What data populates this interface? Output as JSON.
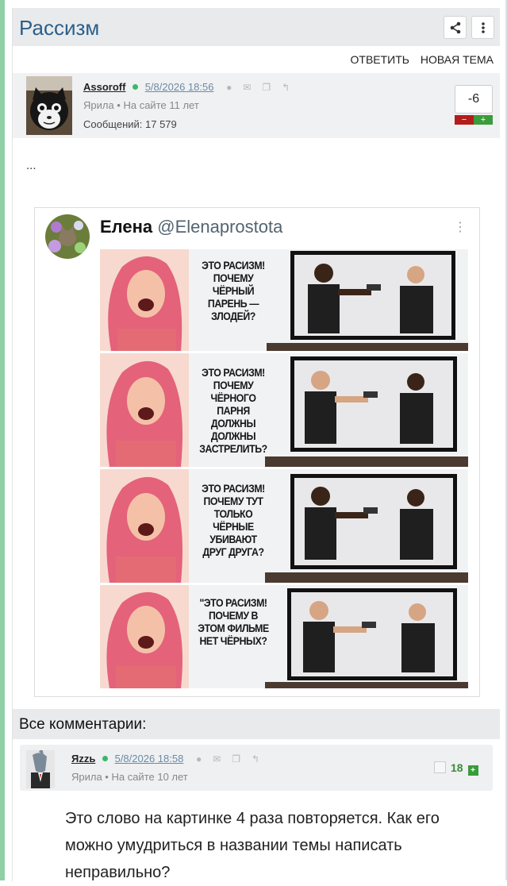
{
  "topic": {
    "title": "Рассизм",
    "actions": [
      "ОТВЕТИТЬ",
      "НОВАЯ ТЕМА"
    ]
  },
  "post": {
    "author": "Assoroff",
    "date": "5/8/2026 18:56",
    "meta": "Ярила • На сайте 11 лет",
    "messages": "Сообщений: 17 579",
    "rating": "-6",
    "rating_minus": "−",
    "rating_plus": "+",
    "body": "..."
  },
  "tweet": {
    "name": "Елена",
    "handle": "@Elenaprostota",
    "panels": [
      {
        "line": "ЭТО РАСИЗМ! ПОЧЕМУ ЧЁРНЫЙ ПАРЕНЬ — ЗЛОДЕЙ?"
      },
      {
        "line": "ЭТО РАСИЗМ! ПОЧЕМУ ЧЁРНОГО ПАРНЯ ДОЛЖНЫ ДОЛЖНЫ ЗАСТРЕЛИТЬ?"
      },
      {
        "line": "ЭТО РАСИЗМ! ПОЧЕМУ ТУТ ТОЛЬКО ЧЁРНЫЕ УБИВАЮТ ДРУГ ДРУГА?"
      },
      {
        "line": "\"ЭТО РАСИЗМ! ПОЧЕМУ В ЭТОМ ФИЛЬМЕ НЕТ ЧЁРНЫХ?"
      }
    ]
  },
  "comments_section": {
    "title": "Все комментарии:"
  },
  "comment": {
    "author": "Яzzь",
    "date": "5/8/2026 18:58",
    "meta": "Ярила • На сайте 10 лет",
    "rating": "18",
    "text": "Это слово на картинке 4 раза повторяется. Как его можно умудриться в названии темы написать неправильно?"
  },
  "colors": {
    "accent": "#2a5f8c",
    "online": "#3bb86a",
    "minus": "#b31d1d",
    "plus": "#3a9c3a"
  },
  "icons": [
    "share-icon",
    "more-vertical-icon",
    "info-icon",
    "mail-icon",
    "quote-icon",
    "reply-icon"
  ]
}
